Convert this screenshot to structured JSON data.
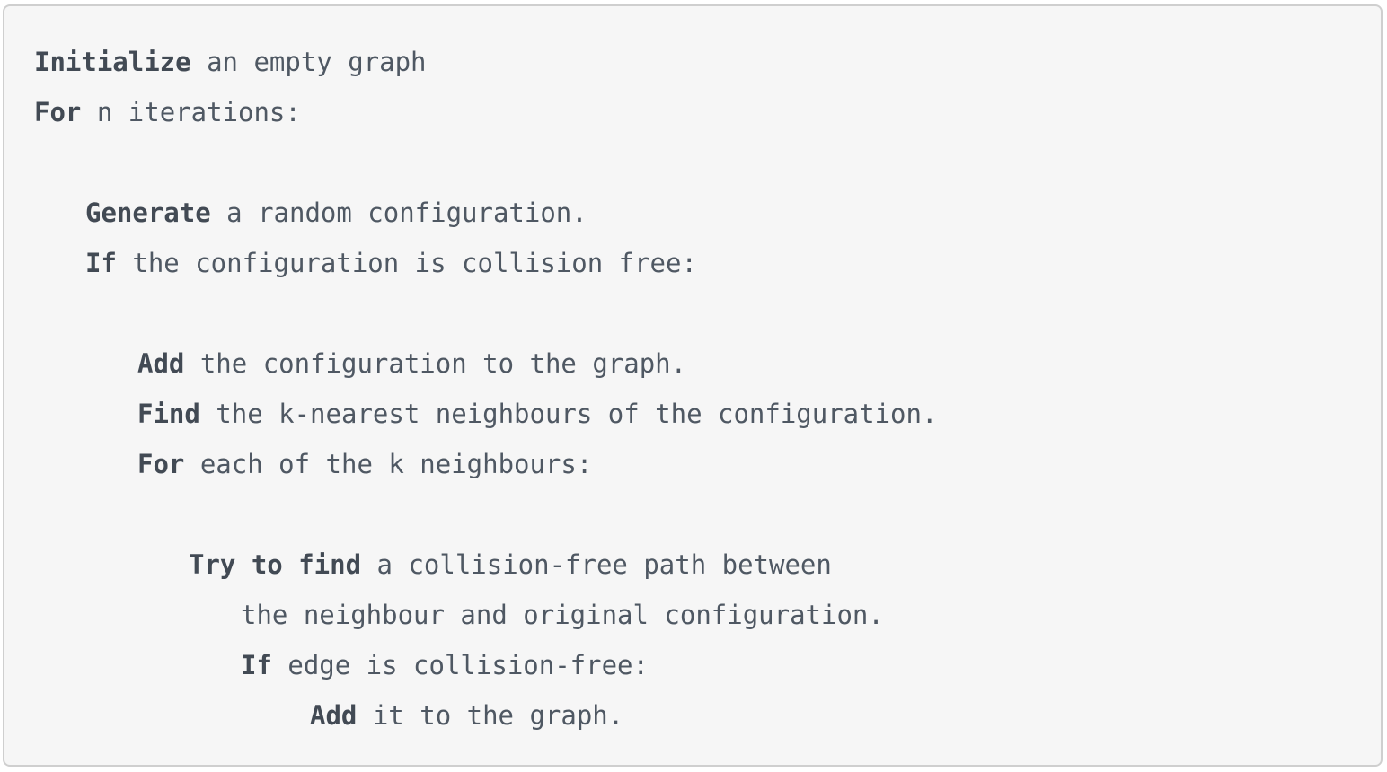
{
  "code": {
    "lines": [
      {
        "keyword": "Initialize",
        "rest": " an empty graph"
      },
      {
        "keyword": "For",
        "rest": " n iterations:"
      },
      {
        "keyword": "Generate",
        "rest": " a random configuration."
      },
      {
        "keyword": "If",
        "rest": " the configuration is collision free:"
      },
      {
        "keyword": "Add",
        "rest": " the configuration to the graph."
      },
      {
        "keyword": "Find",
        "rest": " the k-nearest neighbours of the configuration."
      },
      {
        "keyword": "For",
        "rest": " each of the k neighbours:"
      },
      {
        "keyword": "Try to find",
        "rest": " a collision-free path between"
      },
      {
        "keyword": "",
        "rest": "the neighbour and original configuration."
      },
      {
        "keyword": "If",
        "rest": " edge is collision-free:"
      },
      {
        "keyword": "Add",
        "rest": " it to the graph."
      }
    ]
  }
}
